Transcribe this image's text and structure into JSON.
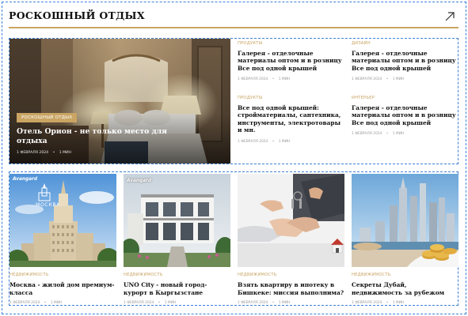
{
  "section": {
    "title": "РОСКОШНЫЙ ОТДЫХ"
  },
  "featured": {
    "category": "РОСКОШНЫЙ ОТДЫХ",
    "title": "Отель Орион - не только место для отдыха",
    "date": "1 ФЕВРАЛЯ 2024",
    "read_time": "1 МИН"
  },
  "side_articles": [
    {
      "category": "ПРОДУКТЫ",
      "title": "Галерея - отделочные материалы оптом и в розницу Все под одной крышей",
      "date": "1 ФЕВРАЛЯ 2024",
      "read_time": "1 МИН"
    },
    {
      "category": "ДИЗАЙН",
      "title": "Галерея - отделочные материалы оптом и в розницу Все под одной крышей",
      "date": "1 ФЕВРАЛЯ 2024",
      "read_time": "1 МИН"
    },
    {
      "category": "ПРОДУКТЫ",
      "title": "Все под одной крышей: стройматериалы, сантехника, инструменты, электротовары и мн.",
      "date": "1 ФЕВРАЛЯ 2024",
      "read_time": "1 МИН"
    },
    {
      "category": "ИНТЕРЬЕР",
      "title": "Галерея - отделочные материалы оптом и в розницу Все под одной крышей",
      "date": "1 ФЕВРАЛЯ 2024",
      "read_time": "1 МИН"
    }
  ],
  "cards": [
    {
      "category": "НЕДВИЖИМОСТЬ",
      "title": "Москва - жилой дом премиум-класса",
      "date": "1 ФЕВРАЛЯ 2024",
      "read_time": "1 МИН",
      "image_logo": "Avangard",
      "image_caption": "МОСКВА"
    },
    {
      "category": "НЕДВИЖИМОСТЬ",
      "title": "UNO City - новый город-курорт в Кыргызстане",
      "date": "1 ФЕВРАЛЯ 2024",
      "read_time": "1 МИН",
      "image_logo": "Avangard"
    },
    {
      "category": "НЕДВИЖИМОСТЬ",
      "title": "Взять квартиру в ипотеку в Бишкеке: миссия выполнима?",
      "date": "1 ФЕВРАЛЯ 2024",
      "read_time": "1 МИН"
    },
    {
      "category": "НЕДВИЖИМОСТЬ",
      "title": "Секреты Дубай, недвижимость за рубежом",
      "date": "1 ФЕВРАЛЯ 2024",
      "read_time": "1 МИН"
    }
  ],
  "meta_separator": "•",
  "icons": {
    "section_link": "arrow-up-right-icon"
  },
  "colors": {
    "accent": "#c9a463",
    "outline": "#3d7fd6",
    "meta": "#9a9a9a"
  }
}
